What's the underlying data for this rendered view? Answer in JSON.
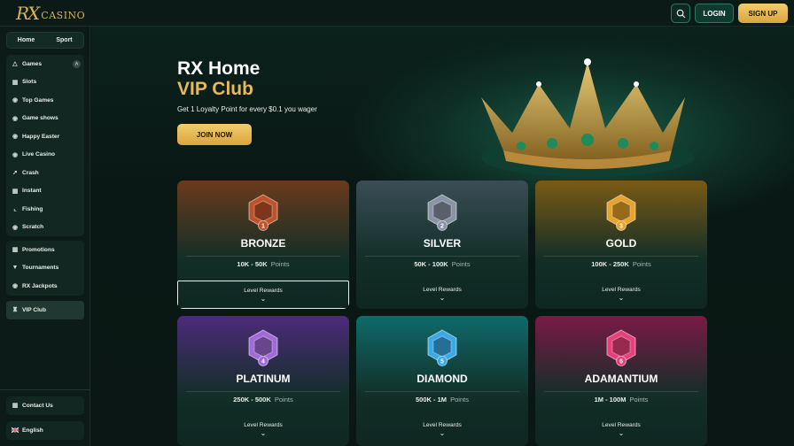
{
  "header": {
    "logo_mark": "RX",
    "logo_text": "CASINO",
    "login_label": "LOGIN",
    "signup_label": "SIGN UP"
  },
  "sidebar": {
    "switch": [
      "Home",
      "Sport"
    ],
    "games": [
      {
        "label": "Games",
        "icon": "gamepad-icon"
      },
      {
        "label": "Slots",
        "icon": "slots-icon"
      },
      {
        "label": "Top Games",
        "icon": "top-games-icon"
      },
      {
        "label": "Game shows",
        "icon": "game-shows-icon"
      },
      {
        "label": "Happy Easter",
        "icon": "easter-icon"
      },
      {
        "label": "Live Casino",
        "icon": "live-casino-icon"
      },
      {
        "label": "Crash",
        "icon": "rocket-icon"
      },
      {
        "label": "Instant",
        "icon": "instant-icon"
      },
      {
        "label": "Fishing",
        "icon": "fishing-icon"
      },
      {
        "label": "Scratch",
        "icon": "scratch-icon"
      }
    ],
    "promos": [
      {
        "label": "Promotions",
        "icon": "gift-icon"
      },
      {
        "label": "Tournaments",
        "icon": "trophy-icon"
      },
      {
        "label": "RX Jackpots",
        "icon": "jackpot-icon"
      }
    ],
    "vip": {
      "label": "VIP Club",
      "icon": "crown-icon"
    },
    "contact": {
      "label": "Contact Us",
      "icon": "chat-icon"
    },
    "language": {
      "label": "English",
      "icon": "uk-flag-icon"
    }
  },
  "hero": {
    "title_line1": "RX Home",
    "title_line2": "VIP Club",
    "subtitle": "Get 1 Loyalty Point for every $0.1 you wager",
    "cta": "JOIN NOW"
  },
  "tiers": [
    {
      "name": "BRONZE",
      "level": "1",
      "range": "10K - 50K",
      "points_label": "Points",
      "rewards_label": "Level Rewards",
      "color": "#c0522a",
      "bg": "#6a3a1c"
    },
    {
      "name": "SILVER",
      "level": "2",
      "range": "50K - 100K",
      "points_label": "Points",
      "rewards_label": "Level Rewards",
      "color": "#8a93a6",
      "bg": "#3b4d55"
    },
    {
      "name": "GOLD",
      "level": "3",
      "range": "100K - 250K",
      "points_label": "Points",
      "rewards_label": "Level Rewards",
      "color": "#e7a32a",
      "bg": "#7a5a14"
    },
    {
      "name": "PLATINUM",
      "level": "4",
      "range": "250K - 500K",
      "points_label": "Points",
      "rewards_label": "Level Rewards",
      "color": "#a06ad8",
      "bg": "#4d2a7a"
    },
    {
      "name": "DIAMOND",
      "level": "5",
      "range": "500K - 1M",
      "points_label": "Points",
      "rewards_label": "Level Rewards",
      "color": "#3aa9e8",
      "bg": "#0f6a6a"
    },
    {
      "name": "ADAMANTIUM",
      "level": "6",
      "range": "1M - 100M",
      "points_label": "Points",
      "rewards_label": "Level Rewards",
      "color": "#e8407a",
      "bg": "#7a1a46"
    }
  ]
}
